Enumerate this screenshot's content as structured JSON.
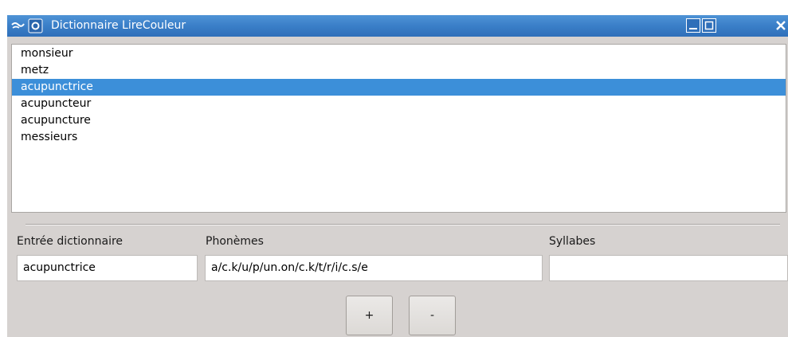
{
  "window": {
    "title": "Dictionnaire LireCouleur"
  },
  "word_list": {
    "items": [
      {
        "text": "monsieur",
        "selected": false
      },
      {
        "text": "metz",
        "selected": false
      },
      {
        "text": "acupunctrice",
        "selected": true
      },
      {
        "text": "acupuncteur",
        "selected": false
      },
      {
        "text": "acupuncture",
        "selected": false
      },
      {
        "text": "messieurs",
        "selected": false
      }
    ]
  },
  "form": {
    "entry_label": "Entrée dictionnaire",
    "entry_value": "acupunctrice",
    "phonemes_label": "Phonèmes",
    "phonemes_value": "a/c.k/u/p/un.on/c.k/t/r/i/c.s/e",
    "syllables_label": "Syllabes",
    "syllables_value": ""
  },
  "buttons": {
    "add_label": "+",
    "remove_label": "-"
  },
  "icons": {
    "app": "libreoffice-gull-icon",
    "menu": "window-menu-icon",
    "minimize": "minimize-icon",
    "maximize": "maximize-icon",
    "close": "close-icon"
  },
  "colors": {
    "titlebar": "#3a7fc8",
    "selection": "#3c8fd9",
    "window_bg": "#d6d2d0"
  }
}
